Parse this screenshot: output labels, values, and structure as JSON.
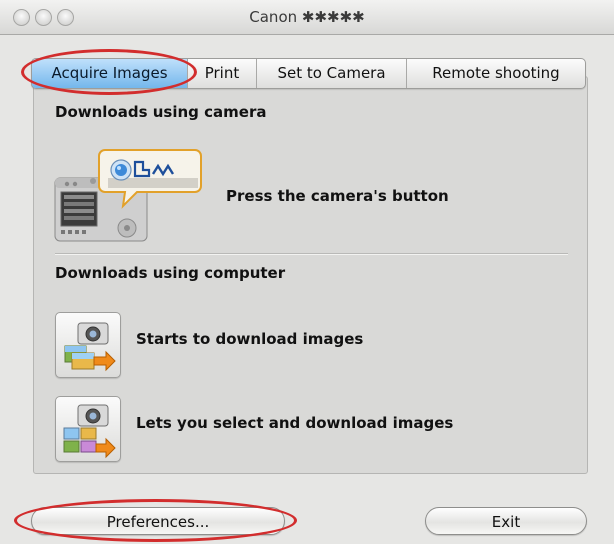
{
  "window": {
    "title": "Canon ✱✱✱✱✱",
    "icons": [
      "close-icon",
      "minimize-icon",
      "zoom-icon"
    ]
  },
  "tabs": [
    {
      "label": "Acquire Images",
      "active": true
    },
    {
      "label": "Print",
      "active": false
    },
    {
      "label": "Set to Camera",
      "active": false
    },
    {
      "label": "Remote shooting",
      "active": false
    }
  ],
  "camera_section": {
    "heading": "Downloads using camera",
    "action_label": "Press the camera's button",
    "icons": [
      "camera-illustration-icon",
      "direct-transfer-icon",
      "print-share-icon",
      "wave-icon"
    ]
  },
  "computer_section": {
    "heading": "Downloads using computer",
    "actions": [
      {
        "label": "Starts to download images",
        "icon": "camera-download-icon"
      },
      {
        "label": "Lets you select and download images",
        "icon": "camera-select-download-icon"
      }
    ]
  },
  "footer": {
    "preferences_label": "Preferences...",
    "exit_label": "Exit"
  },
  "colors": {
    "highlight_oval": "#d22d2d",
    "active_tab": "#74b7ec",
    "window_bg": "#e6e6e4"
  }
}
